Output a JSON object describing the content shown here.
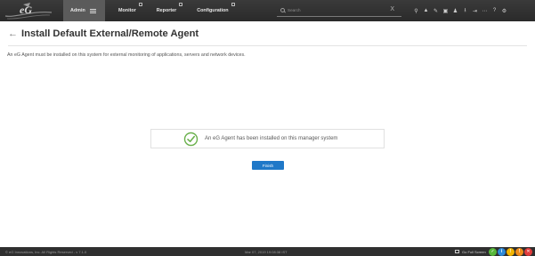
{
  "nav": {
    "items": [
      {
        "label": "Admin",
        "active": true
      },
      {
        "label": "Monitor"
      },
      {
        "label": "Reporter"
      },
      {
        "label": "Configuration"
      }
    ],
    "search_placeholder": "Search",
    "search_clear": "X",
    "tool_icons": [
      "search-icon",
      "alert-icon",
      "tools-icon",
      "layers-icon",
      "user-icon",
      "download-icon",
      "signout-icon",
      "more-icon",
      "help-icon",
      "settings-icon"
    ],
    "tool_glyphs": [
      "⚲",
      "▲",
      "✎",
      "▣",
      "♟",
      "⭳",
      "⇥",
      "⋯",
      "?",
      "⚙"
    ]
  },
  "page": {
    "back": "←",
    "title": "Install Default External/Remote Agent",
    "description": "An eG Agent must be installed on this system for external monitoring of applications, servers and network devices."
  },
  "message": {
    "text": "An eG Agent has been installed on this manager system",
    "icon": "check-circle-icon",
    "icon_color": "#6ab04c"
  },
  "actions": {
    "finish": "Finish"
  },
  "footer": {
    "copyright": "© eG Innovations, Inc. All Rights Reserved - v 7.1.0",
    "timestamp": "Mar 07, 2019 19:08:38 IST",
    "fullscreen": "Go Full Screen",
    "status": [
      {
        "name": "normal-status-icon",
        "color": "#57b83a",
        "glyph": "✓"
      },
      {
        "name": "info-status-icon",
        "color": "#2e8ad8",
        "glyph": "i"
      },
      {
        "name": "warning-status-icon",
        "color": "#f2b400",
        "glyph": "!"
      },
      {
        "name": "major-status-icon",
        "color": "#f08c1a",
        "glyph": "!"
      },
      {
        "name": "critical-status-icon",
        "color": "#e23d3d",
        "glyph": "✕"
      }
    ]
  },
  "colors": {
    "topbar": "#2f2f2f",
    "accent": "#1f78c8",
    "success": "#6ab04c"
  }
}
